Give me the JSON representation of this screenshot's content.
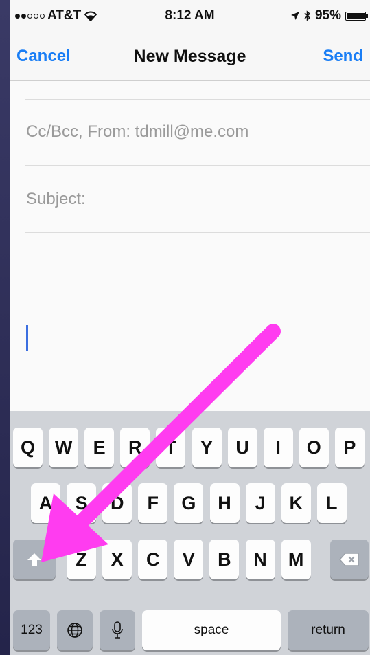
{
  "status_bar": {
    "carrier": "AT&T",
    "time": "8:12 AM",
    "battery": "95%",
    "battery_level": 0.95
  },
  "nav": {
    "cancel": "Cancel",
    "title": "New Message",
    "send": "Send"
  },
  "compose": {
    "cc_from": "Cc/Bcc, From: tdmill@me.com",
    "subject": "Subject:"
  },
  "keyboard": {
    "row1": [
      "Q",
      "W",
      "E",
      "R",
      "T",
      "Y",
      "U",
      "I",
      "O",
      "P"
    ],
    "row2": [
      "A",
      "S",
      "D",
      "F",
      "G",
      "H",
      "J",
      "K",
      "L"
    ],
    "row3": [
      "Z",
      "X",
      "C",
      "V",
      "B",
      "N",
      "M"
    ],
    "numbers": "123",
    "space": "space",
    "return": "return"
  },
  "colors": {
    "accent": "#1a7ef5",
    "annotation_arrow": "#ff3cf0"
  }
}
